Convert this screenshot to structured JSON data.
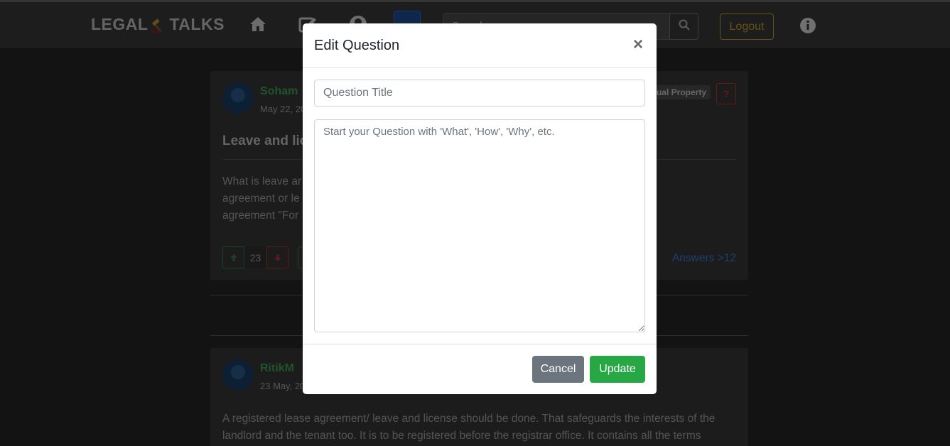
{
  "navbar": {
    "brand_left": "LEGAL",
    "brand_right": "TALKS",
    "search_placeholder": "Search",
    "logout_label": "Logout"
  },
  "question": {
    "author": "Soham",
    "date": "May 22, 20",
    "category": "ual Property",
    "report_label": "?",
    "title": "Leave and lice                                                                           operty",
    "body_lines": [
      "What is leave ar                                                                                        st normal lease",
      "agreement or le                                                                                       included in the",
      "agreement \"For"
    ],
    "upvote_count": "23",
    "answers_label": "Answers >12"
  },
  "answer": {
    "author": "RitikM",
    "date": "23 May, 20",
    "body": "A registered lease agreement/ leave and license should be done. That safeguards the interests of the landlord and the tenant too. It is to be registered before the registrar office. It contains all the terms"
  },
  "modal": {
    "title": "Edit Question",
    "close_label": "×",
    "title_placeholder": "Question Title",
    "body_placeholder": "Start your Question with 'What', 'How', 'Why', etc.",
    "cancel_label": "Cancel",
    "update_label": "Update"
  },
  "colors": {
    "accent_green": "#28a745",
    "cancel_gray": "#6c757d",
    "logout_gold": "#c9a227",
    "link_blue": "#3b7ddd"
  }
}
